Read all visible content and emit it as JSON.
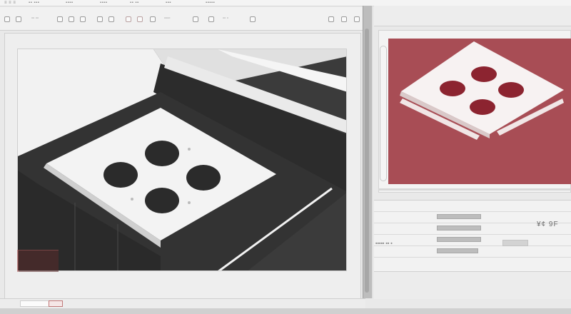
{
  "menu": [
    {
      "label": "≡ ≡ ≡"
    },
    {
      "label": "▪▪ ▪▪▪"
    },
    {
      "label": "▪▪▪▪"
    },
    {
      "label": "▪▪▪▪"
    },
    {
      "label": "▪▪ ▪▪"
    },
    {
      "label": "▪▪▪"
    },
    {
      "label": "▪▪▪▪▪"
    }
  ],
  "toolbar": {
    "text_a": "▫▫ ▫▫",
    "text_b": "▫▫▫▫",
    "text_c": "▫▫ ▫"
  },
  "properties": {
    "value": "¥¢ 9F",
    "row_label": "▪▪▪▪▪ ▪▪ ▪"
  },
  "colors": {
    "preview_bg": "#a84d55",
    "part_dark": "#3b3b3b",
    "hole_red": "#8c2430"
  },
  "icons": [
    "viewport-scene",
    "preview-scene",
    "splitter-grip"
  ]
}
